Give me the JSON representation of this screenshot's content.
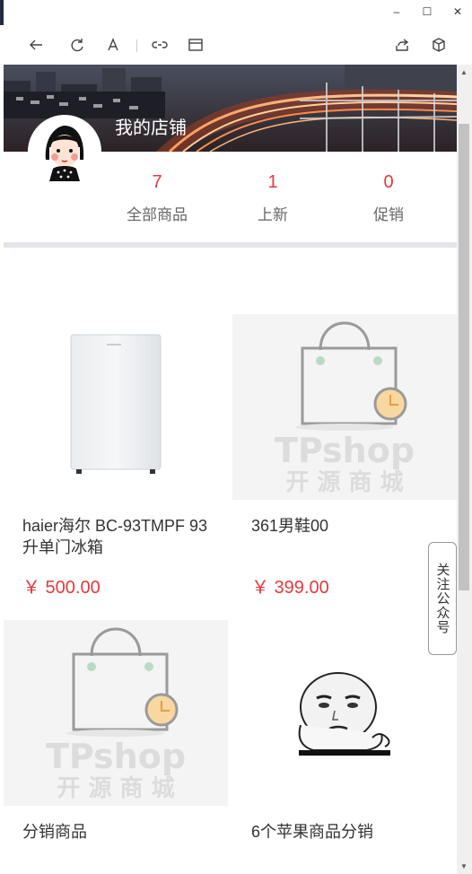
{
  "window": {
    "controls": {
      "minimize": "–",
      "maximize": "☐",
      "close": "✕"
    }
  },
  "toolbar": {
    "icons": [
      "back-icon",
      "refresh-icon",
      "font-icon",
      "link-icon",
      "layout-icon",
      "share-icon",
      "cube-icon"
    ]
  },
  "store": {
    "name": "我的店铺"
  },
  "stats": [
    {
      "value": "7",
      "label": "全部商品"
    },
    {
      "value": "1",
      "label": "上新"
    },
    {
      "value": "0",
      "label": "促销"
    }
  ],
  "products": [
    {
      "name": "haier海尔 BC-93TMPF 93升单门冰箱",
      "price": "￥ 500.00",
      "image": "fridge"
    },
    {
      "name": "361男鞋00",
      "price": "￥ 399.00",
      "image": "tpshop-placeholder"
    },
    {
      "name": "分销商品",
      "price": "",
      "image": "tpshop-placeholder"
    },
    {
      "name": "6个苹果商品分销",
      "price": "",
      "image": "meme-face"
    }
  ],
  "placeholder": {
    "brand": "TPshop",
    "tagline": "开 源 商 城"
  },
  "follow_button": "关注公众号",
  "colors": {
    "price": "#e4393c",
    "divider": "#e4e4ea"
  }
}
